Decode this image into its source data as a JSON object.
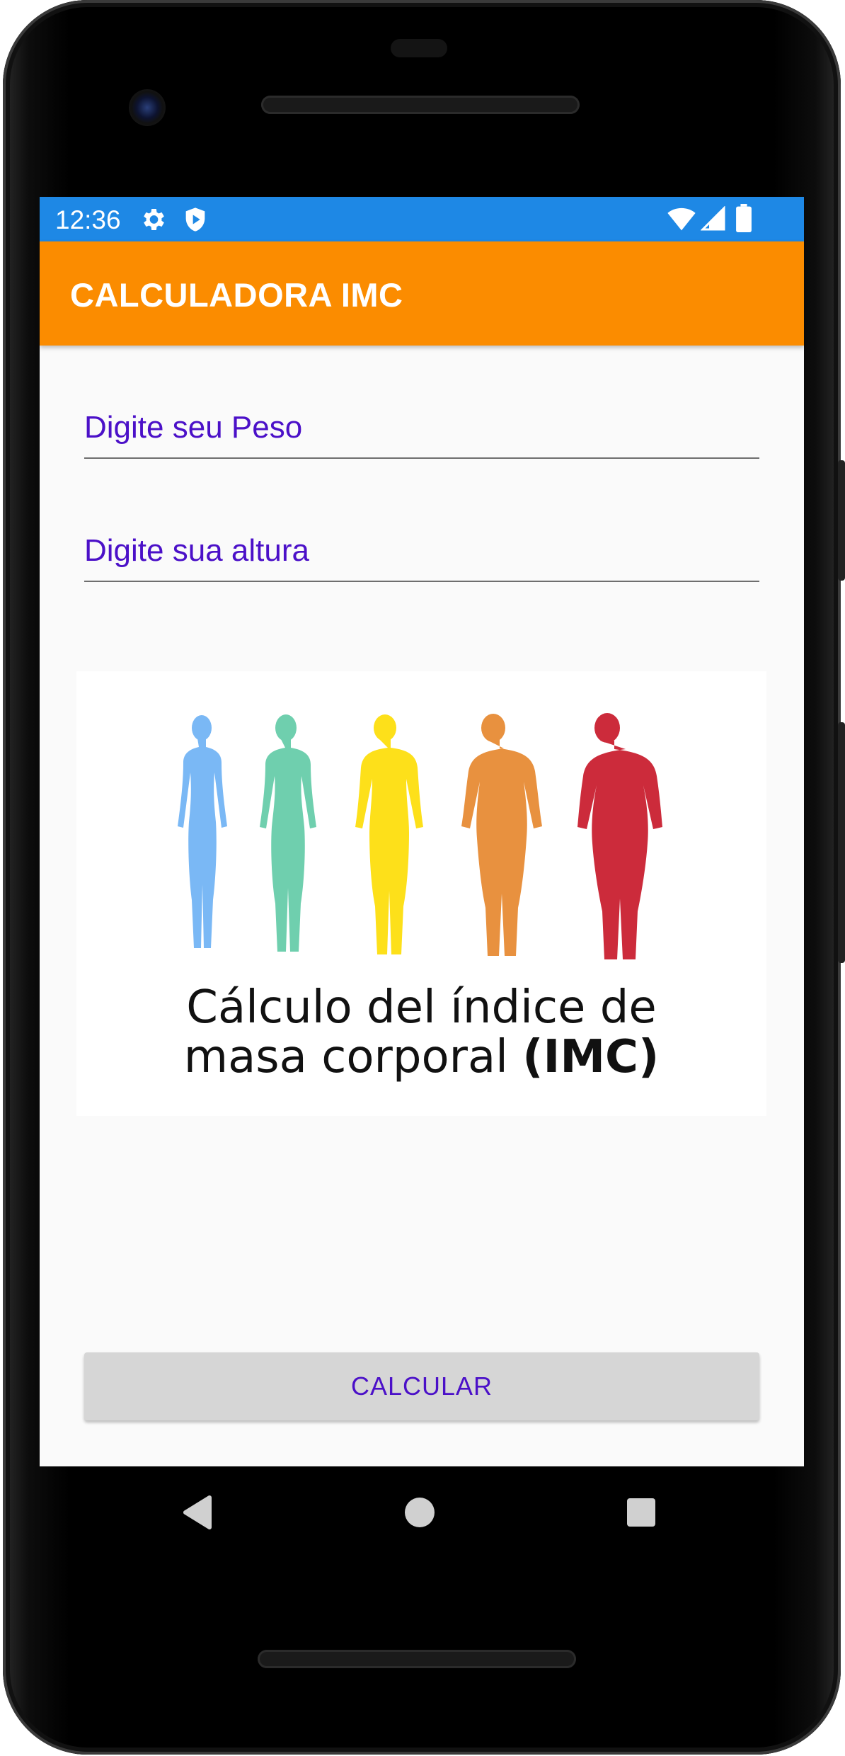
{
  "status_bar": {
    "time": "12:36",
    "icons": [
      "gear-icon",
      "shield-icon",
      "wifi-icon",
      "cell-signal-icon",
      "battery-icon"
    ],
    "background_color": "#1e88e5"
  },
  "app_bar": {
    "title": "CALCULADORA IMC",
    "background_color": "#fb8c00"
  },
  "form": {
    "weight_placeholder": "Digite seu Peso",
    "weight_value": "",
    "height_placeholder": "Digite sua altura",
    "height_value": ""
  },
  "illustration": {
    "caption_line1": "Cálculo del índice de",
    "caption_line2_regular": "masa corporal ",
    "caption_line2_bold": "(IMC)",
    "figure_colors": [
      "#7ab8f5",
      "#6fcfae",
      "#fde01a",
      "#e8913f",
      "#cc2b3b"
    ]
  },
  "actions": {
    "calculate_label": "CALCULAR"
  },
  "nav_bar": {
    "icons": [
      "back-icon",
      "home-icon",
      "recent-apps-icon"
    ]
  }
}
